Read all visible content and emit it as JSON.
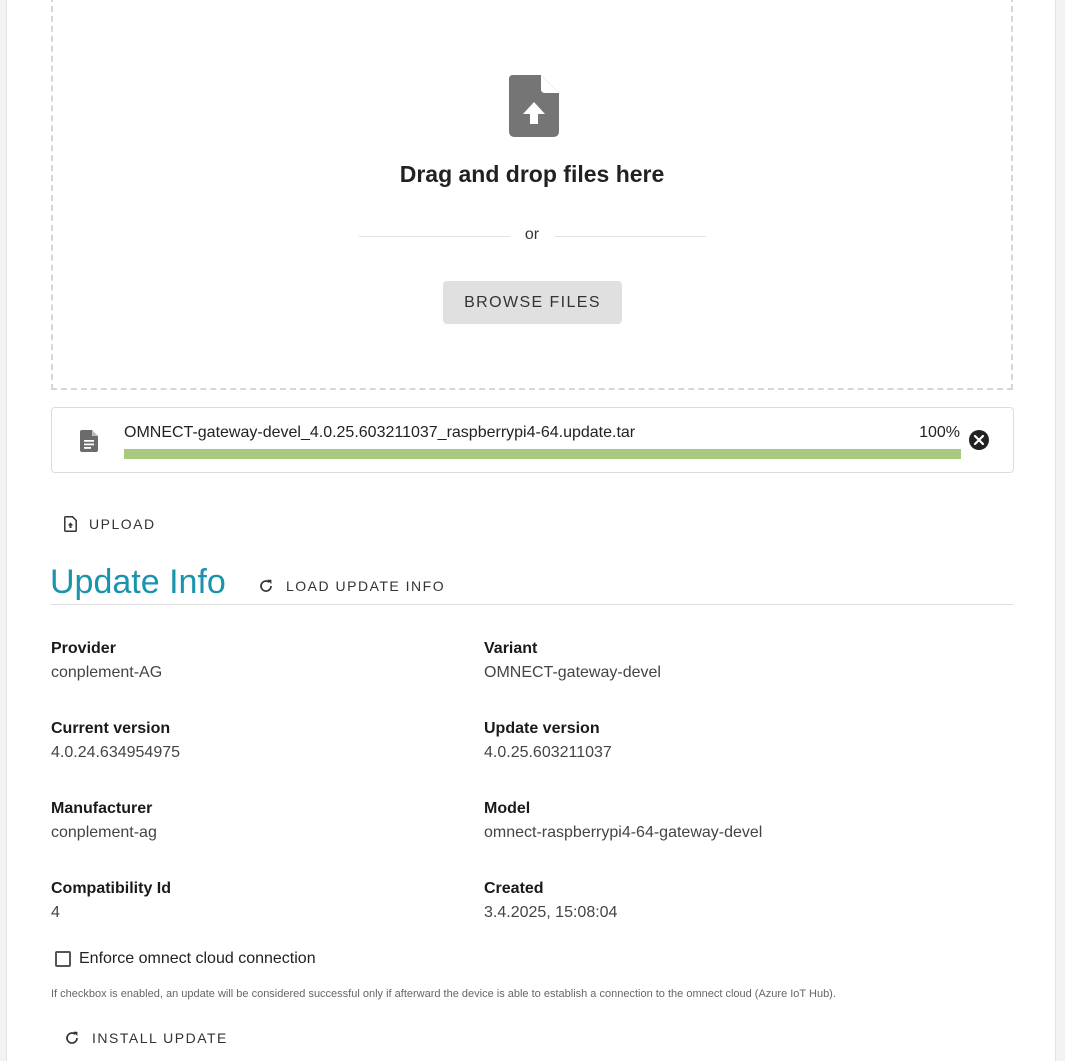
{
  "dropzone": {
    "title": "Drag and drop files here",
    "or_text": "or",
    "browse_label": "BROWSE FILES",
    "icon": "file-upload-icon"
  },
  "file": {
    "name": "OMNECT-gateway-devel_4.0.25.603211037_raspberrypi4-64.update.tar",
    "progress_text": "100%",
    "progress": 1.0,
    "icon": "file-document-icon",
    "remove_icon": "close-circle-icon"
  },
  "actions": {
    "upload_label": "UPLOAD",
    "load_update_info_label": "LOAD UPDATE INFO",
    "install_update_label": "INSTALL UPDATE"
  },
  "update_info": {
    "title": "Update Info",
    "fields": [
      {
        "label": "Provider",
        "value": "conplement-AG"
      },
      {
        "label": "Variant",
        "value": "OMNECT-gateway-devel"
      },
      {
        "label": "Current version",
        "value": "4.0.24.634954975"
      },
      {
        "label": "Update version",
        "value": "4.0.25.603211037"
      },
      {
        "label": "Manufacturer",
        "value": "conplement-ag"
      },
      {
        "label": "Model",
        "value": "omnect-raspberrypi4-64-gateway-devel"
      },
      {
        "label": "Compatibility Id",
        "value": "4"
      },
      {
        "label": "Created",
        "value": "3.4.2025, 15:08:04"
      }
    ]
  },
  "enforce_cloud": {
    "label": "Enforce omnect cloud connection",
    "checked": false,
    "help": "If checkbox is enabled, an update will be considered successful only if afterward the device is able to establish a connection to the omnect cloud (Azure IoT Hub)."
  },
  "colors": {
    "accent": "#1a94ad",
    "progress": "#a8c97f",
    "icon_gray": "#757575"
  }
}
